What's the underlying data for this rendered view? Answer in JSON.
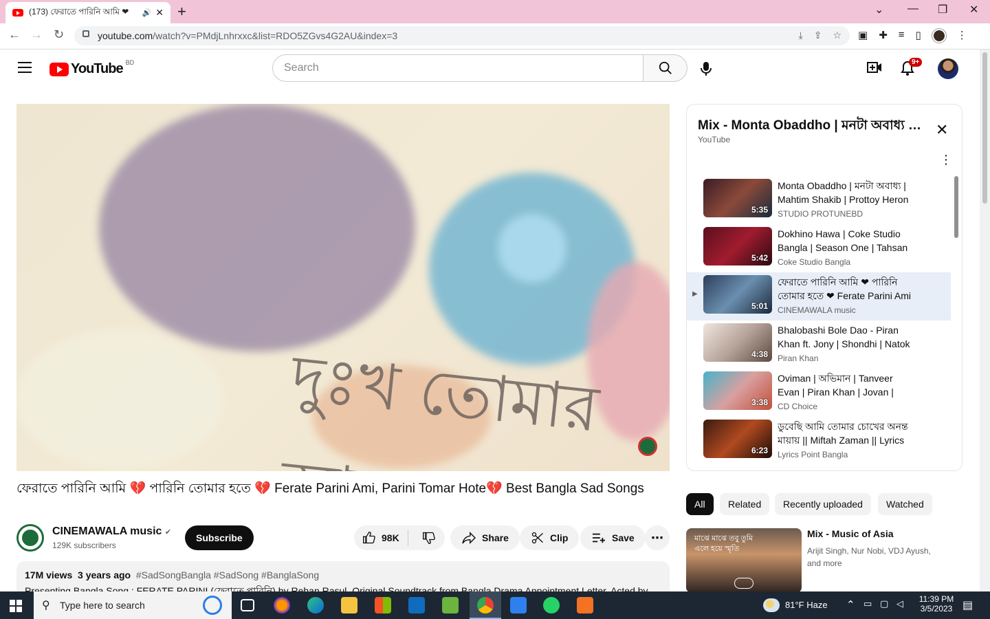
{
  "browser": {
    "tab_title": "(173) ফেরাতে পারিনি আমি ❤ ",
    "tab_close": "✕",
    "new_tab": "+",
    "url_host": "youtube.com",
    "url_path": "/watch?v=PMdjLnhrxxc&list=RDO5ZGvs4G2AU&index=3"
  },
  "header": {
    "logo_text": "YouTube",
    "country_code": "BD",
    "search_placeholder": "Search",
    "notification_count": "9+"
  },
  "video": {
    "overlay_text": "দুঃখ তোমার আছে",
    "title": "ফেরাতে পারিনি আমি 💔 পারিনি তোমার হতে 💔 Ferate Parini Ami, Parini Tomar Hote💔 Best Bangla Sad Songs",
    "channel_name": "CINEMAWALA music",
    "channel_verified": "✔",
    "subscribers": "129K subscribers",
    "subscribe_label": "Subscribe",
    "likes": "98K",
    "share_label": "Share",
    "clip_label": "Clip",
    "save_label": "Save",
    "more_label": "⋯",
    "views": "17M views",
    "age": "3 years ago",
    "tags": "#SadSongBangla #SadSong #BanglaSong",
    "description_line": "Presenting Bangla Song : FERATE PARINI (ফেরাতে পারিনি) by Rehan Rasul. Original Soundtrack from Bangla Drama Appointment Letter. Acted by"
  },
  "playlist": {
    "title": "Mix - Monta Obaddho | মনটা অবাধ্য | Mahtim Shakib",
    "subtitle": "YouTube",
    "items": [
      {
        "title": "Monta Obaddho | মনটা অবাধ্য | Mahtim Shakib | Prottoy Heron",
        "channel": "STUDIO PROTUNEBD",
        "duration": "5:35",
        "index": ""
      },
      {
        "title": "Dokhino Hawa | Coke Studio Bangla | Season One | Tahsan",
        "channel": "Coke Studio Bangla",
        "duration": "5:42",
        "index": ""
      },
      {
        "title": "ফেরাতে পারিনি আমি ❤ পারিনি তোমার হতে ❤ Ferate Parini Ami",
        "channel": "CINEMAWALA music",
        "duration": "5:01",
        "index": "▶"
      },
      {
        "title": "Bhalobashi Bole Dao - Piran Khan ft. Jony | Shondhi | Natok",
        "channel": "Piran Khan",
        "duration": "4:38",
        "index": ""
      },
      {
        "title": "Oviman | অভিমান | Tanveer Evan | Piran Khan | Jovan | Tasnia",
        "channel": "CD Choice",
        "duration": "3:38",
        "index": ""
      },
      {
        "title": "ডুবেছি আমি তোমার চোখের অনন্ত মায়ায় || Miftah Zaman || Lyrics",
        "channel": "Lyrics Point Bangla",
        "duration": "6:23",
        "index": ""
      }
    ]
  },
  "chips": [
    "All",
    "Related",
    "Recently uploaded",
    "Watched"
  ],
  "recommendation": {
    "title": "Mix - Music of Asia",
    "subtitle": "Arijit Singh, Nur Nobi, VDJ Ayush, and more",
    "thumb_text": "মাঝে মাঝে তবু তুমি এলে হয়ে স্মৃতি"
  },
  "taskbar": {
    "search_placeholder": "Type here to search",
    "weather": "81°F  Haze",
    "time": "11:39 PM",
    "date": "3/5/2023"
  },
  "colors": {
    "tab_strip": "#f2c4d8",
    "youtube_red": "#ff0000",
    "taskbar": "#1c2733",
    "active_playlist": "#e8eef8"
  }
}
